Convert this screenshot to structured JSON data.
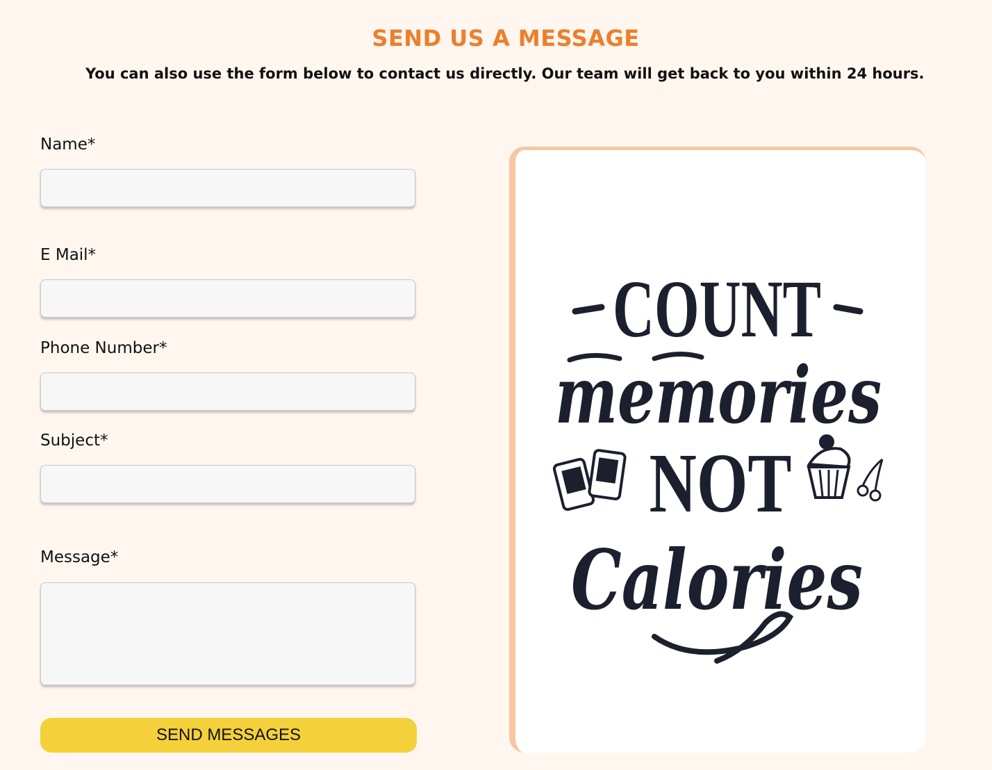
{
  "section": {
    "heading": "SEND US A MESSAGE",
    "subheading": "You can also use the form below to contact us directly. Our team will get back to you within 24 hours."
  },
  "form": {
    "name_label": "Name*",
    "name_value": "",
    "email_label": "E Mail*",
    "email_value": "",
    "phone_label": "Phone Number*",
    "phone_value": "",
    "subject_label": "Subject*",
    "subject_value": "",
    "message_label": "Message*",
    "message_value": "",
    "submit_label": "SEND MESSAGES"
  },
  "illustration": {
    "line1": "-COUNT-",
    "line2": "memories",
    "line3": "NOT",
    "line4": "Calories",
    "icons": [
      "cards-icon",
      "cupcake-icon",
      "cherries-icon"
    ]
  },
  "colors": {
    "accent": "#ec7f2c",
    "button": "#f4d03a",
    "page_background": "#fff6f0",
    "card_border": "#f7c6a1",
    "ink": "#1c1f2e"
  }
}
